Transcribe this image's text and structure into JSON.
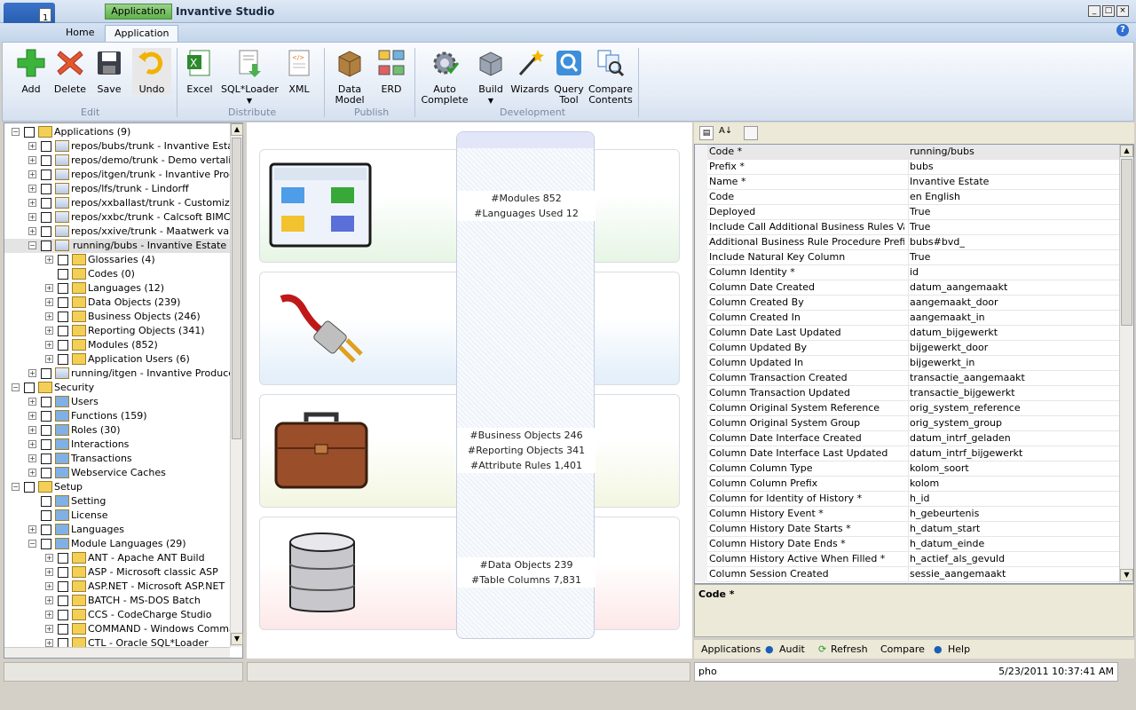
{
  "window": {
    "context_tab": "Application",
    "title": "Invantive Studio",
    "qat_badge": "1"
  },
  "tabs": [
    {
      "label": "Home"
    },
    {
      "label": "Application"
    }
  ],
  "ribbon": {
    "groups": [
      {
        "label": "Edit",
        "buttons": [
          {
            "label": "Add"
          },
          {
            "label": "Delete"
          },
          {
            "label": "Save"
          },
          {
            "label": "Undo"
          }
        ]
      },
      {
        "label": "Distribute",
        "buttons": [
          {
            "label": "Excel"
          },
          {
            "label": "SQL*Loader"
          },
          {
            "label": "XML"
          }
        ]
      },
      {
        "label": "Publish",
        "buttons": [
          {
            "label": "Data",
            "label2": "Model"
          },
          {
            "label": "ERD"
          }
        ]
      },
      {
        "label": "Development",
        "buttons": [
          {
            "label": "Auto",
            "label2": "Complete"
          },
          {
            "label": "Build"
          },
          {
            "label": "Wizards"
          },
          {
            "label": "Query",
            "label2": "Tool"
          },
          {
            "label": "Compare",
            "label2": "Contents"
          }
        ]
      }
    ]
  },
  "tree": [
    {
      "l": 0,
      "t": "Applications (9)",
      "e": "-"
    },
    {
      "l": 1,
      "t": "repos/bubs/trunk - Invantive Estate",
      "e": "+"
    },
    {
      "l": 1,
      "t": "repos/demo/trunk - Demo vertalinge",
      "e": "+"
    },
    {
      "l": 1,
      "t": "repos/itgen/trunk - Invantive Produc",
      "e": "+"
    },
    {
      "l": 1,
      "t": "repos/lfs/trunk - Lindorff",
      "e": "+"
    },
    {
      "l": 1,
      "t": "repos/xxballast/trunk - Customization",
      "e": "+"
    },
    {
      "l": 1,
      "t": "repos/xxbc/trunk - Calcsoft BIMCalc",
      "e": "+"
    },
    {
      "l": 1,
      "t": "repos/xxive/trunk - Maatwerk van In",
      "e": "+"
    },
    {
      "l": 1,
      "t": "running/bubs - Invantive Estate",
      "e": "-",
      "sel": true
    },
    {
      "l": 2,
      "t": "Glossaries (4)",
      "e": "+"
    },
    {
      "l": 2,
      "t": "Codes (0)",
      "e": ""
    },
    {
      "l": 2,
      "t": "Languages (12)",
      "e": "+"
    },
    {
      "l": 2,
      "t": "Data Objects (239)",
      "e": "+"
    },
    {
      "l": 2,
      "t": "Business Objects (246)",
      "e": "+"
    },
    {
      "l": 2,
      "t": "Reporting Objects (341)",
      "e": "+"
    },
    {
      "l": 2,
      "t": "Modules (852)",
      "e": "+"
    },
    {
      "l": 2,
      "t": "Application Users (6)",
      "e": "+"
    },
    {
      "l": 1,
      "t": "running/itgen - Invantive Producer",
      "e": "+"
    },
    {
      "l": 0,
      "t": "Security",
      "e": "-"
    },
    {
      "l": 1,
      "t": "Users",
      "e": "+"
    },
    {
      "l": 1,
      "t": "Functions (159)",
      "e": "+"
    },
    {
      "l": 1,
      "t": "Roles (30)",
      "e": "+"
    },
    {
      "l": 1,
      "t": "Interactions",
      "e": "+"
    },
    {
      "l": 1,
      "t": "Transactions",
      "e": "+"
    },
    {
      "l": 1,
      "t": "Webservice Caches",
      "e": "+"
    },
    {
      "l": 0,
      "t": "Setup",
      "e": "-"
    },
    {
      "l": 1,
      "t": "Setting",
      "e": ""
    },
    {
      "l": 1,
      "t": "License",
      "e": ""
    },
    {
      "l": 1,
      "t": "Languages",
      "e": "+"
    },
    {
      "l": 1,
      "t": "Module Languages (29)",
      "e": "-"
    },
    {
      "l": 2,
      "t": "ANT - Apache ANT Build",
      "e": "+"
    },
    {
      "l": 2,
      "t": "ASP - Microsoft classic ASP",
      "e": "+"
    },
    {
      "l": 2,
      "t": "ASP.NET - Microsoft ASP.NET",
      "e": "+"
    },
    {
      "l": 2,
      "t": "BATCH - MS-DOS Batch",
      "e": "+"
    },
    {
      "l": 2,
      "t": "CCS - CodeCharge Studio",
      "e": "+"
    },
    {
      "l": 2,
      "t": "COMMAND - Windows Command",
      "e": "+"
    },
    {
      "l": 2,
      "t": "CTL - Oracle SQL*Loader",
      "e": "+"
    }
  ],
  "cards": [
    {
      "stats": [
        "#Modules 852",
        "#Languages Used 12"
      ]
    },
    {
      "stats": []
    },
    {
      "stats": [
        "#Business Objects 246",
        "#Reporting Objects 341",
        "#Attribute Rules 1,401"
      ]
    },
    {
      "stats": [
        "#Data Objects 239",
        "#Table Columns 7,831"
      ]
    }
  ],
  "properties": [
    [
      "Code *",
      "running/bubs"
    ],
    [
      "Prefix *",
      "bubs"
    ],
    [
      "Name *",
      "Invantive Estate"
    ],
    [
      "Code",
      "en  English"
    ],
    [
      "Deployed",
      "True"
    ],
    [
      "Include Call Additional Business Rules Value",
      "True"
    ],
    [
      "Additional Business Rule Procedure Prefix",
      "bubs#bvd_"
    ],
    [
      "Include Natural Key Column",
      "True"
    ],
    [
      "Column Identity *",
      "id"
    ],
    [
      "Column Date Created",
      "datum_aangemaakt"
    ],
    [
      "Column Created By",
      "aangemaakt_door"
    ],
    [
      "Column Created In",
      "aangemaakt_in"
    ],
    [
      "Column Date Last Updated",
      "datum_bijgewerkt"
    ],
    [
      "Column Updated By",
      "bijgewerkt_door"
    ],
    [
      "Column Updated In",
      "bijgewerkt_in"
    ],
    [
      "Column Transaction Created",
      "transactie_aangemaakt"
    ],
    [
      "Column Transaction Updated",
      "transactie_bijgewerkt"
    ],
    [
      "Column Original System Reference",
      "orig_system_reference"
    ],
    [
      "Column Original System Group",
      "orig_system_group"
    ],
    [
      "Column Date Interface Created",
      "datum_intrf_geladen"
    ],
    [
      "Column Date Interface Last Updated",
      "datum_intrf_bijgewerkt"
    ],
    [
      "Column Column Type",
      "kolom_soort"
    ],
    [
      "Column Column Prefix",
      "kolom"
    ],
    [
      "Column for Identity of History *",
      "h_id"
    ],
    [
      "Column History Event *",
      "h_gebeurtenis"
    ],
    [
      "Column History Date Starts *",
      "h_datum_start"
    ],
    [
      "Column History Date Ends *",
      "h_datum_einde"
    ],
    [
      "Column History Active When Filled *",
      "h_actief_als_gevuld"
    ],
    [
      "Column Session Created",
      "sessie_aangemaakt"
    ]
  ],
  "desc": {
    "title": "Code *"
  },
  "bottom_tabs": [
    {
      "label": "Applications"
    },
    {
      "label": "Audit"
    },
    {
      "label": "Refresh"
    },
    {
      "label": "Compare"
    },
    {
      "label": "Help"
    }
  ],
  "status": {
    "user": "pho",
    "timestamp": "5/23/2011 10:37:41 AM"
  }
}
